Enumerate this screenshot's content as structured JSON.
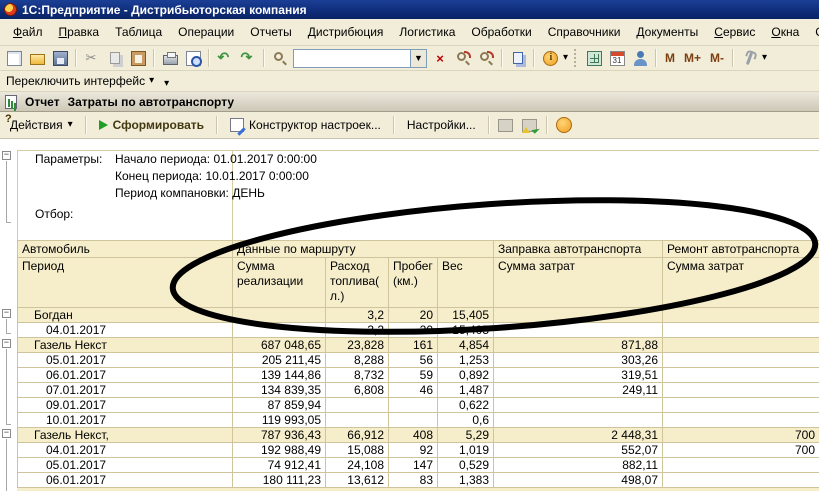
{
  "window": {
    "title": "1С:Предприятие - Дистрибьюторская компания"
  },
  "menu": {
    "items": [
      {
        "label": "Файл",
        "accel": 0
      },
      {
        "label": "Правка",
        "accel": 0
      },
      {
        "label": "Таблица",
        "accel": -1
      },
      {
        "label": "Операции",
        "accel": -1
      },
      {
        "label": "Отчеты",
        "accel": -1
      },
      {
        "label": "Дистрибюция",
        "accel": -1
      },
      {
        "label": "Логистика",
        "accel": -1
      },
      {
        "label": "Обработки",
        "accel": -1
      },
      {
        "label": "Справочники",
        "accel": -1
      },
      {
        "label": "Документы",
        "accel": -1
      },
      {
        "label": "Сервис",
        "accel": 0
      },
      {
        "label": "Окна",
        "accel": 0
      },
      {
        "label": "Справка",
        "accel": 2
      }
    ]
  },
  "toolbar": {
    "combo_value": "",
    "memory_buttons": [
      "M",
      "M+",
      "M-"
    ],
    "icons": [
      "new-document",
      "open-folder",
      "save",
      "cut",
      "copy",
      "paste",
      "print",
      "print-preview",
      "undo",
      "redo",
      "find",
      "combobox",
      "clear",
      "zoom-in",
      "zoom-out",
      "copy-pages",
      "info",
      "calculator",
      "calendar",
      "user-lock",
      "tools"
    ]
  },
  "interface_bar": {
    "label": "Переключить интерфейс"
  },
  "report_window": {
    "prefix": "Отчет",
    "title": "Затраты по автотранспорту"
  },
  "action_bar": {
    "actions_label": "Действия",
    "generate_label": "Сформировать",
    "constructor_label": "Конструктор настроек...",
    "settings_label": "Настройки..."
  },
  "parameters": {
    "label": "Параметры:",
    "line_start": "Начало периода: 01.01.2017 0:00:00",
    "line_end": "Конец периода: 10.01.2017 0:00:00",
    "line_period": "Период компановки: ДЕНЬ",
    "filter_label": "Отбор:"
  },
  "table": {
    "group_headers": [
      "Автомобиль",
      "Данные по маршруту",
      "Заправка автотранспорта",
      "Ремонт автотранспорта"
    ],
    "columns": [
      "Период",
      "Сумма реализации",
      "Расход топлива(л.)",
      "Пробег(км.)",
      "Вес",
      "Сумма затрат",
      "Сумма затрат"
    ],
    "rows": [
      {
        "label": "Богдан",
        "type": "group",
        "values": [
          "",
          "3,2",
          "20",
          "15,405",
          "",
          ""
        ]
      },
      {
        "label": "04.01.2017",
        "type": "date",
        "values": [
          "",
          "3,2",
          "20",
          "15,405",
          "",
          ""
        ]
      },
      {
        "label": "Газель Некст",
        "type": "group",
        "values": [
          "687 048,65",
          "23,828",
          "161",
          "4,854",
          "871,88",
          ""
        ]
      },
      {
        "label": "05.01.2017",
        "type": "date",
        "values": [
          "205 211,45",
          "8,288",
          "56",
          "1,253",
          "303,26",
          ""
        ]
      },
      {
        "label": "06.01.2017",
        "type": "date",
        "values": [
          "139 144,86",
          "8,732",
          "59",
          "0,892",
          "319,51",
          ""
        ]
      },
      {
        "label": "07.01.2017",
        "type": "date",
        "values": [
          "134 839,35",
          "6,808",
          "46",
          "1,487",
          "249,11",
          ""
        ]
      },
      {
        "label": "09.01.2017",
        "type": "date",
        "values": [
          "87 859,94",
          "",
          "",
          "0,622",
          "",
          ""
        ]
      },
      {
        "label": "10.01.2017",
        "type": "date",
        "values": [
          "119 993,05",
          "",
          "",
          "0,6",
          "",
          ""
        ]
      },
      {
        "label": "Газель Некст,",
        "type": "group",
        "values": [
          "787 936,43",
          "66,912",
          "408",
          "5,29",
          "2 448,31",
          "700"
        ]
      },
      {
        "label": "04.01.2017",
        "type": "date",
        "values": [
          "192 988,49",
          "15,088",
          "92",
          "1,019",
          "552,07",
          "700"
        ]
      },
      {
        "label": "05.01.2017",
        "type": "date",
        "values": [
          "74 912,41",
          "24,108",
          "147",
          "0,529",
          "882,11",
          ""
        ]
      },
      {
        "label": "06.01.2017",
        "type": "date",
        "values": [
          "180 111,23",
          "13,612",
          "83",
          "1,383",
          "498,07",
          ""
        ]
      }
    ]
  },
  "colors": {
    "titlebar": "#0c2a74",
    "chrome_bg": "#f1edd9",
    "header_bg": "#f6eecb",
    "grid": "#cfc59c",
    "annotation": "#000000"
  }
}
